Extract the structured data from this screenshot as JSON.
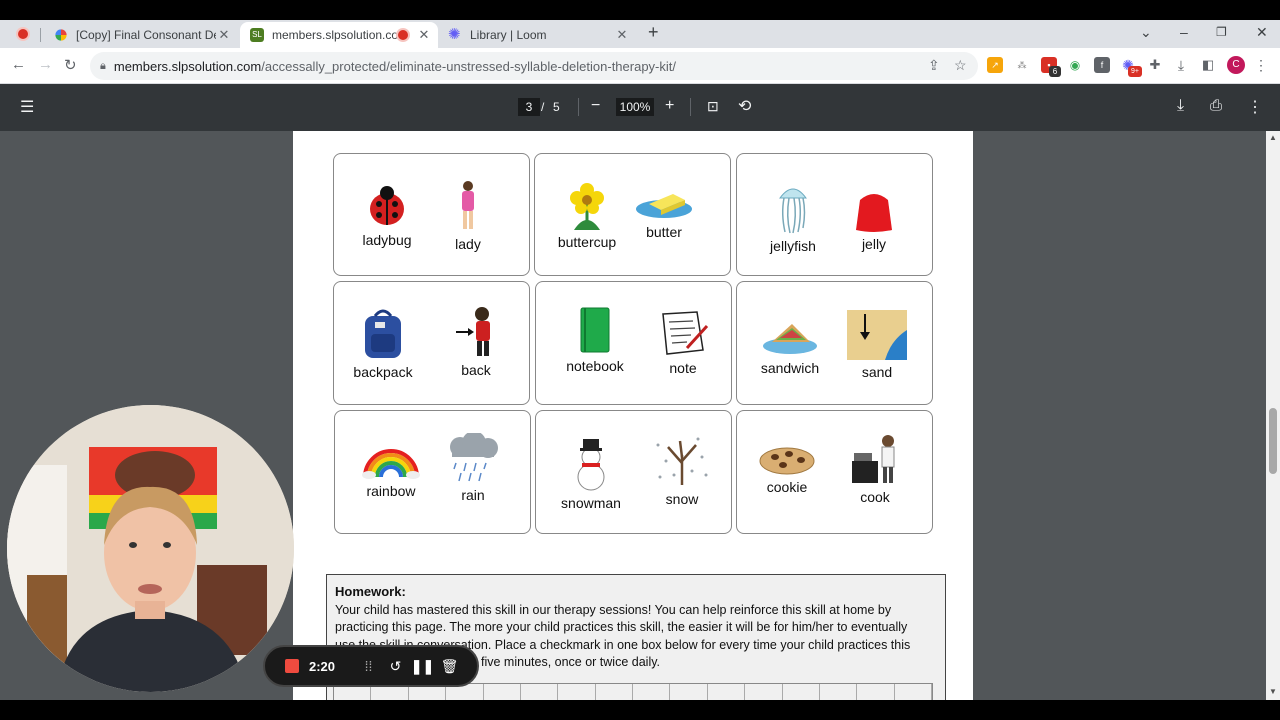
{
  "tabs": [
    {
      "title": "[Copy] Final Consonant Deletion",
      "fav_color": "#e8453c"
    },
    {
      "title": "members.slpsolution.com/a",
      "fav_color": "#5a8f29"
    },
    {
      "title": "Library | Loom",
      "fav_color": "#625df5"
    }
  ],
  "window": {
    "new_tab": "+",
    "tab_search": "⌄",
    "minimize": "–",
    "restore": "❐",
    "close": "✕"
  },
  "address": {
    "host": "members.slpsolution.com",
    "path": "/accessally_protected/eliminate-unstressed-syllable-deletion-therapy-kit/"
  },
  "browser": {
    "profile_initial": "C",
    "ext_badge_1": "6",
    "ext_badge_2": "9+"
  },
  "pdf": {
    "current_page": "3",
    "page_sep": "/",
    "total_pages": "5",
    "zoom": "100%"
  },
  "cards": [
    {
      "left": {
        "word": "ladybug",
        "icon": "ladybug-icon"
      },
      "right": {
        "word": "lady",
        "icon": "lady-icon"
      }
    },
    {
      "left": {
        "word": "buttercup",
        "icon": "flower-icon"
      },
      "right": {
        "word": "butter",
        "icon": "butter-icon"
      }
    },
    {
      "left": {
        "word": "jellyfish",
        "icon": "jellyfish-icon"
      },
      "right": {
        "word": "jelly",
        "icon": "jelly-icon"
      }
    },
    {
      "left": {
        "word": "backpack",
        "icon": "backpack-icon"
      },
      "right": {
        "word": "back",
        "icon": "back-icon"
      }
    },
    {
      "left": {
        "word": "notebook",
        "icon": "notebook-icon"
      },
      "right": {
        "word": "note",
        "icon": "note-icon"
      }
    },
    {
      "left": {
        "word": "sandwich",
        "icon": "sandwich-icon"
      },
      "right": {
        "word": "sand",
        "icon": "sand-icon"
      }
    },
    {
      "left": {
        "word": "rainbow",
        "icon": "rainbow-icon"
      },
      "right": {
        "word": "rain",
        "icon": "rain-icon"
      }
    },
    {
      "left": {
        "word": "snowman",
        "icon": "snowman-icon"
      },
      "right": {
        "word": "snow",
        "icon": "snow-icon"
      }
    },
    {
      "left": {
        "word": "cookie",
        "icon": "cookie-icon"
      },
      "right": {
        "word": "cook",
        "icon": "cook-icon"
      }
    }
  ],
  "homework": {
    "heading": "Homework:",
    "line1": "Your child has mastered this skill in our therapy sessions! You can help reinforce this skill at home by",
    "line2": "practicing this page. The more your child practices this skill, the easier it will be for him/her to eventually",
    "line3": "use the skill in conversation. Place a checkmark in one box below for every time your child practices this",
    "line4": "five minutes, once or twice daily."
  },
  "loom": {
    "elapsed": "2:20"
  },
  "colors": {
    "pdf_toolbar": "#323639",
    "viewer_bg": "#525659",
    "loom_stop": "#ef4b3f"
  }
}
